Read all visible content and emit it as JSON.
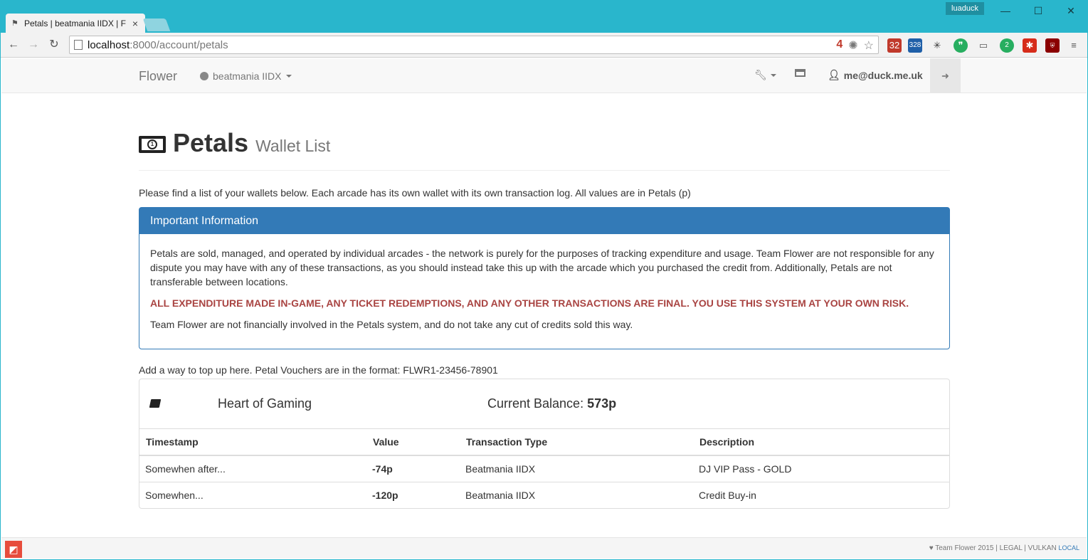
{
  "browser": {
    "tab_title": "Petals | beatmania IIDX | F",
    "url_host": "localhost",
    "url_path": ":8000/account/petals",
    "profile": "luaduck",
    "ext_badges": [
      "32",
      "328",
      "2"
    ]
  },
  "navbar": {
    "brand": "Flower",
    "game": "beatmania IIDX",
    "user": "me@duck.me.uk"
  },
  "page": {
    "title": "Petals",
    "subtitle": "Wallet List",
    "intro": "Please find a list of your wallets below. Each arcade has its own wallet with its own transaction log. All values are in Petals (p)"
  },
  "info_panel": {
    "heading": "Important Information",
    "para1": "Petals are sold, managed, and operated by individual arcades - the network is purely for the purposes of tracking expenditure and usage. Team Flower are not responsible for any dispute you may have with any of these transactions, as you should instead take this up with the arcade which you purchased the credit from. Additionally, Petals are not transferable between locations.",
    "warning": "ALL EXPENDITURE MADE IN-GAME, ANY TICKET REDEMPTIONS, AND ANY OTHER TRANSACTIONS ARE FINAL. YOU USE THIS SYSTEM AT YOUR OWN RISK.",
    "para2": "Team Flower are not financially involved in the Petals system, and do not take any cut of credits sold this way."
  },
  "voucher_text": "Add a way to top up here. Petal Vouchers are in the format: FLWR1-23456-78901",
  "wallet": {
    "arcade": "Heart of Gaming",
    "balance_label": "Current Balance:",
    "balance_value": "573p",
    "columns": [
      "Timestamp",
      "Value",
      "Transaction Type",
      "Description"
    ],
    "rows": [
      {
        "timestamp": "Somewhen after...",
        "value": "-74p",
        "type": "Beatmania IIDX",
        "description": "DJ VIP Pass - GOLD"
      },
      {
        "timestamp": "Somewhen...",
        "value": "-120p",
        "type": "Beatmania IIDX",
        "description": "Credit Buy-in"
      }
    ]
  },
  "footer": {
    "text": "Team Flower 2015 | LEGAL | VULKAN",
    "env": "LOCAL"
  }
}
